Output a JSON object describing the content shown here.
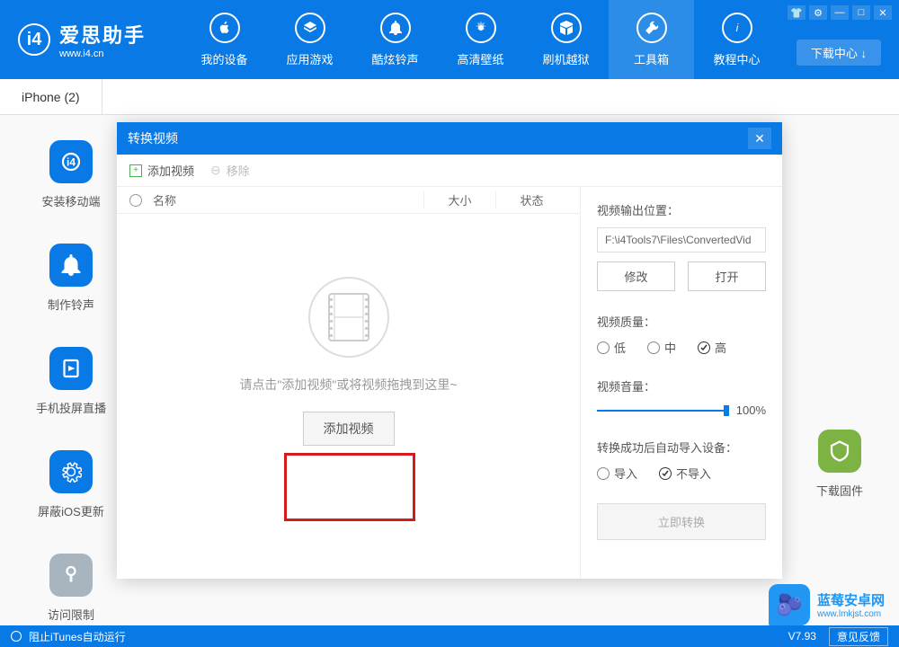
{
  "header": {
    "logo_main": "爱思助手",
    "logo_sub": "www.i4.cn",
    "download_center": "下载中心 ↓",
    "nav": [
      {
        "label": "我的设备"
      },
      {
        "label": "应用游戏"
      },
      {
        "label": "酷炫铃声"
      },
      {
        "label": "高清壁纸"
      },
      {
        "label": "刷机越狱"
      },
      {
        "label": "工具箱"
      },
      {
        "label": "教程中心"
      }
    ]
  },
  "tabs": [
    {
      "label": "iPhone (2)"
    }
  ],
  "sidebar": {
    "items": [
      {
        "label": "安装移动端"
      },
      {
        "label": "制作铃声"
      },
      {
        "label": "手机投屏直播"
      },
      {
        "label": "屏蔽iOS更新"
      },
      {
        "label": "访问限制"
      }
    ]
  },
  "right_item": {
    "label": "下载固件"
  },
  "modal": {
    "title": "转换视频",
    "toolbar": {
      "add": "添加视频",
      "remove": "移除"
    },
    "table": {
      "name": "名称",
      "size": "大小",
      "status": "状态"
    },
    "empty_hint": "请点击\"添加视频\"或将视频拖拽到这里~",
    "add_btn": "添加视频",
    "right": {
      "output_label": "视频输出位置：",
      "output_path": "F:\\i4Tools7\\Files\\ConvertedVid",
      "modify": "修改",
      "open": "打开",
      "quality_label": "视频质量：",
      "quality_low": "低",
      "quality_mid": "中",
      "quality_high": "高",
      "volume_label": "视频音量：",
      "volume_val": "100%",
      "auto_import_label": "转换成功后自动导入设备：",
      "import_yes": "导入",
      "import_no": "不导入",
      "convert_btn": "立即转换"
    }
  },
  "footer": {
    "itunes": "阻止iTunes自动运行",
    "version": "V7.93",
    "feedback": "意见反馈"
  },
  "watermark": {
    "main": "蓝莓安卓网",
    "sub": "www.lmkjst.com"
  }
}
